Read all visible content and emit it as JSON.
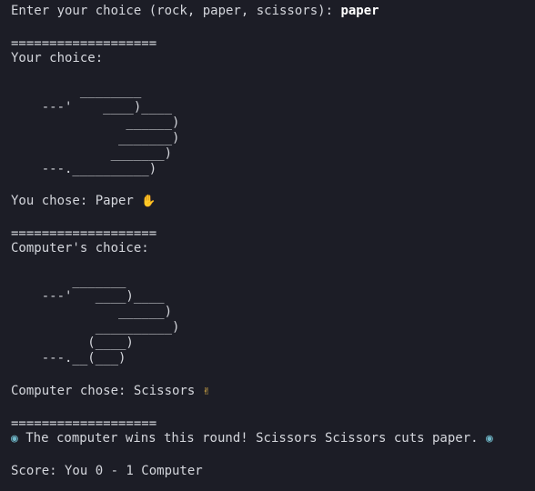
{
  "prompt": {
    "text": "Enter your choice (rock, paper, scissors): ",
    "value": "paper"
  },
  "separators": [
    "===================",
    "===================",
    "==================="
  ],
  "player": {
    "header": "Your choice:",
    "art": [
      "         ________",
      "    ---'    ____)____",
      "               ______)",
      "              _______)",
      "             _______)",
      "    ---.__________)"
    ],
    "result_text": "You chose: Paper ",
    "result_icon": "waving-hand"
  },
  "computer": {
    "header": "Computer's choice:",
    "art": [
      "        _______",
      "    ---'   ____)____",
      "              ______)",
      "           __________)",
      "          (____)",
      "    ---.__(___)"
    ],
    "result_text": "Computer chose: Scissors ",
    "result_icon": "victory-hand"
  },
  "outcome": {
    "text": " The computer wins this round! Scissors Scissors cuts paper. ",
    "icon": "robot"
  },
  "score": {
    "text": "Score: You 0 - 1 Computer"
  },
  "colors": {
    "background": "#1c1d26",
    "foreground": "#d4d6dc",
    "input": "#ffffff"
  }
}
